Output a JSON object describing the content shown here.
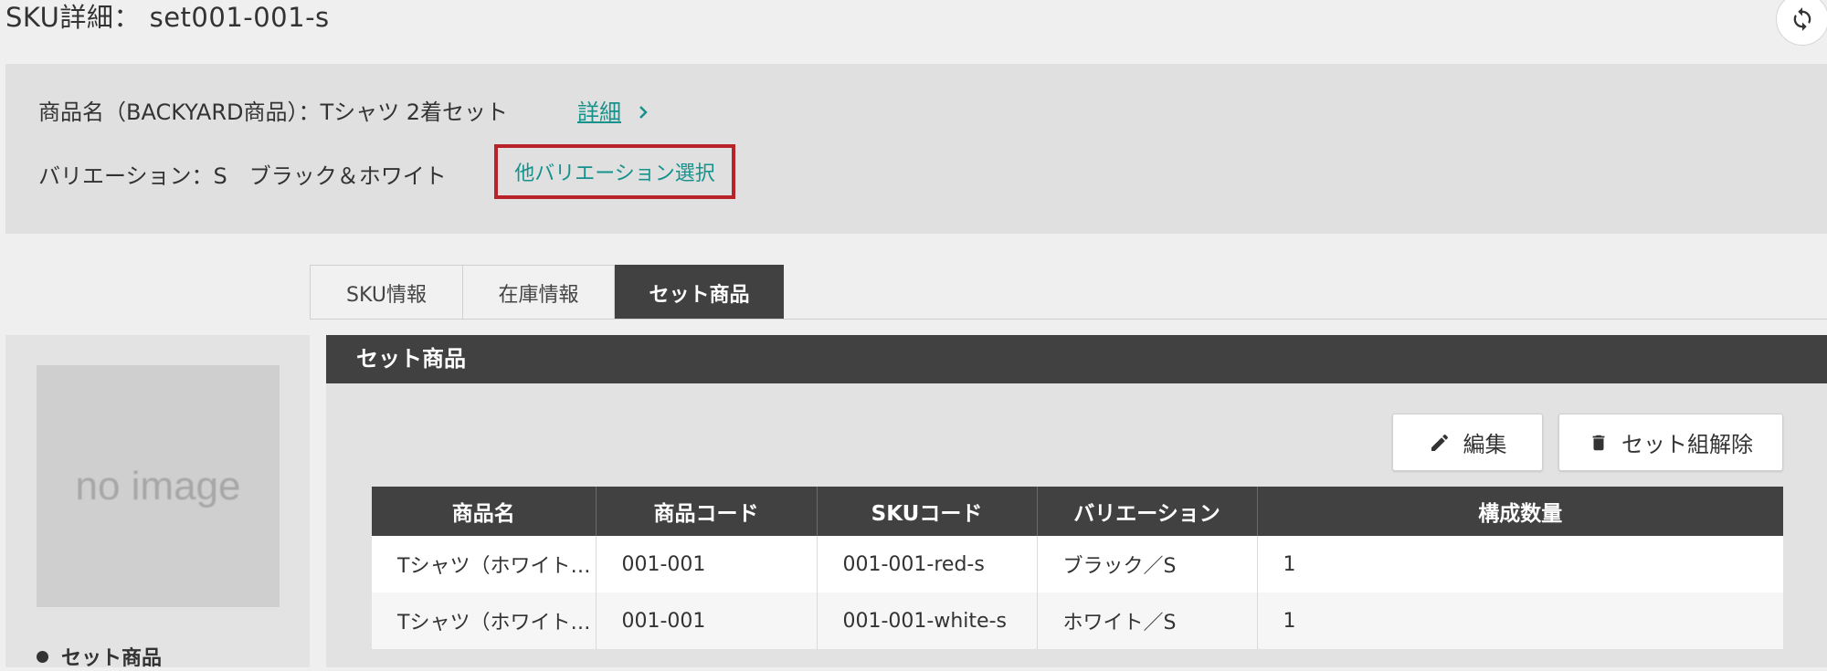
{
  "page": {
    "title": "SKU詳細： set001-001-s"
  },
  "info": {
    "product_name": "商品名（BACKYARD商品）：Tシャツ 2着セット",
    "detail_link": "詳細",
    "variation": "バリエーション：S　ブラック＆ホワイト",
    "other_variation_button": "他バリエーション選択"
  },
  "tabs": [
    {
      "label": "SKU情報",
      "active": false
    },
    {
      "label": "在庫情報",
      "active": false
    },
    {
      "label": "セット商品",
      "active": true
    }
  ],
  "sidebar": {
    "image_placeholder": "no image",
    "items": [
      {
        "label": "セット商品"
      }
    ]
  },
  "section": {
    "title": "セット商品",
    "edit_button": "編集",
    "unset_button": "セット組解除"
  },
  "table": {
    "columns": [
      "商品名",
      "商品コード",
      "SKUコード",
      "バリエーション",
      "構成数量"
    ],
    "rows": [
      [
        "Tシャツ（ホワイト…",
        "001-001",
        "001-001-red-s",
        "ブラック／S",
        "1"
      ],
      [
        "Tシャツ（ホワイト…",
        "001-001",
        "001-001-white-s",
        "ホワイト／S",
        "1"
      ]
    ]
  },
  "icons": {
    "refresh": "refresh-icon",
    "chevron": "chevron-right-icon",
    "pencil": "pencil-icon",
    "trash": "trash-icon"
  },
  "colors": {
    "accent": "#16928c",
    "highlight_border": "#b8232a",
    "dark_header": "#414141"
  }
}
